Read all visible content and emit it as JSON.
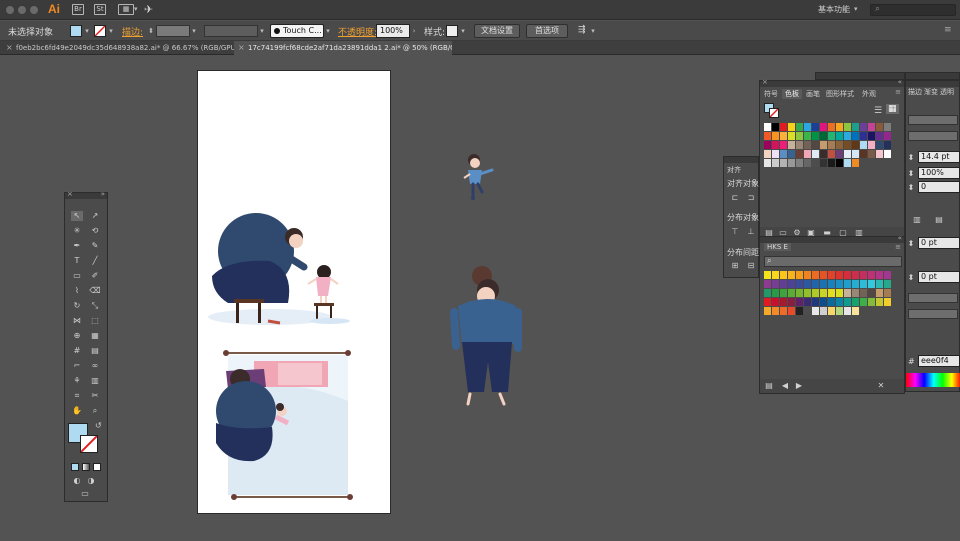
{
  "menubar": {
    "app_logo": "Ai",
    "workspace": "基本功能",
    "search_placeholder": ""
  },
  "control_bar": {
    "selection_status": "未选择对象",
    "stroke_label": "描边:",
    "brush": "Touch C...",
    "opacity_label": "不透明度:",
    "opacity_value": "100%",
    "style_label": "样式:",
    "doc_setup_button": "文档设置",
    "preferences_button": "首选项"
  },
  "tabs": [
    {
      "label": "f0eb2bc6fd49e2049dc35d648938a82.ai* @ 66.67% (RGB/GPU 预览)",
      "active": false
    },
    {
      "label": "17c74199fcf68cde2af71da23891dda1 2.ai* @ 50% (RGB/GPU 预览)",
      "active": true
    }
  ],
  "swatches_panel": {
    "tabs": [
      "符号",
      "色板",
      "画笔",
      "图形样式",
      "外观"
    ],
    "active_tab": "色板"
  },
  "align_panel": {
    "title": "对齐",
    "align_objects": "对齐对象",
    "distribute_objects": "分布对象",
    "distribute_spacing": "分布间距"
  },
  "hks_panel": {
    "title": "HKS E"
  },
  "right_panel": {
    "tabs": [
      "描边",
      "渐变",
      "透明"
    ],
    "weight_field": "14.4 pt",
    "scale_field": "100%",
    "angle_field": "0",
    "offset_field_1": "0 pt",
    "offset_field_2": "0 pt",
    "hex_value": "eee0f4"
  },
  "colors": {
    "accent": "#f08a24",
    "canvas": "#535353",
    "panel": "#4b4b4b",
    "fill_swatch": "#aedaf2"
  }
}
